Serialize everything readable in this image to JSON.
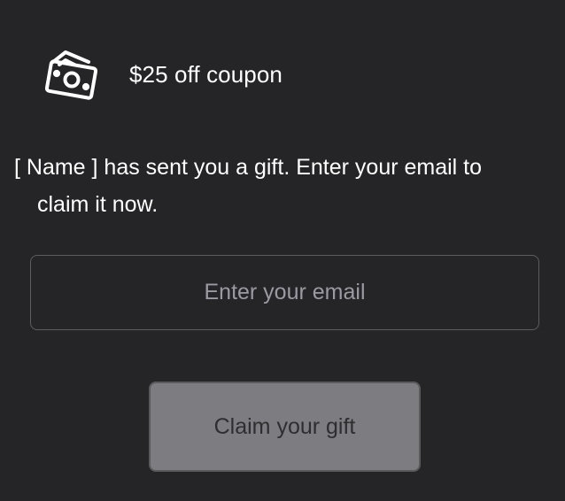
{
  "coupon": {
    "icon": "money-bills-icon",
    "title": "$25 off coupon"
  },
  "message": {
    "line1": "[ Name ] has sent you a gift. Enter your email to",
    "line2": "claim it now."
  },
  "email": {
    "placeholder": "Enter your email",
    "value": ""
  },
  "claim_button": {
    "label": "Claim your gift"
  },
  "colors": {
    "background": "#252527",
    "text": "#ffffff",
    "input_border": "#5d5d61",
    "placeholder": "#9b9aa2",
    "button_background": "#7d7c80",
    "button_text": "#2e2e31"
  }
}
